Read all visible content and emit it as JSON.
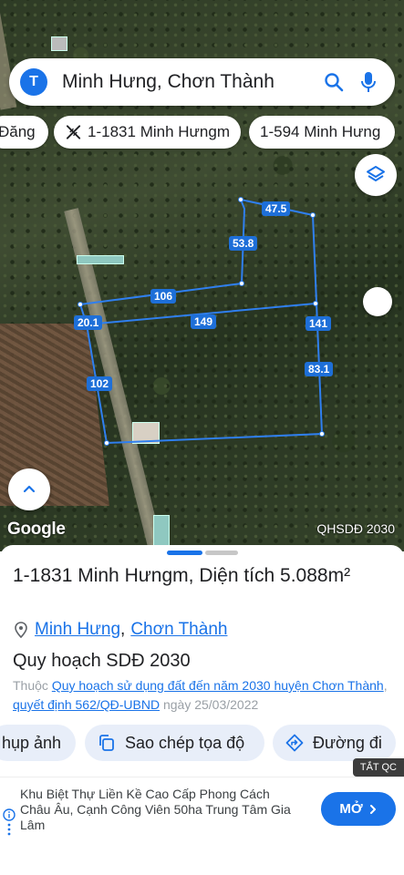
{
  "search": {
    "avatar_letter": "T",
    "query": "Minh Hưng, Chơn Thành"
  },
  "chips": [
    {
      "label": "Đăng"
    },
    {
      "label": "1-1831 Minh Hưngm"
    },
    {
      "label": "1-594 Minh Hưng"
    }
  ],
  "map": {
    "edge_lengths": [
      "47.5",
      "53.8",
      "106",
      "20.1",
      "149",
      "141",
      "83.1",
      "102"
    ],
    "google_logo": "Google",
    "layer_label": "QHSDĐ 2030",
    "parcel_color": "#1e6fd8"
  },
  "place": {
    "title": "1-1831 Minh Hưngm, Diện tích 5.088m²",
    "location_link1": "Minh Hưng",
    "location_sep": ",",
    "location_link2": "Chơn Thành",
    "plan_title": "Quy hoạch SDĐ 2030",
    "plan_prefix": "Thuộc",
    "plan_link": "Quy hoạch sử dụng đất đến năm 2030 huyện Chơn Thành",
    "plan_sep": ",",
    "decision_link": "quyết định 562/QĐ-UBND",
    "decision_date": "ngày 25/03/2022"
  },
  "actions": [
    {
      "label": "hụp ảnh",
      "icon": "camera-icon"
    },
    {
      "label": "Sao chép tọa độ",
      "icon": "copy-icon"
    },
    {
      "label": "Đường đi",
      "icon": "directions-icon"
    }
  ],
  "ad": {
    "tag": "TẮT QC",
    "text": "Khu Biệt Thự Liền Kề Cao Cấp Phong Cách Châu Âu, Cạnh Công Viên 50ha Trung Tâm Gia Lâm",
    "button": "MỞ"
  },
  "colors": {
    "accent": "#1a73e8",
    "action_bg": "#e8eef9"
  }
}
